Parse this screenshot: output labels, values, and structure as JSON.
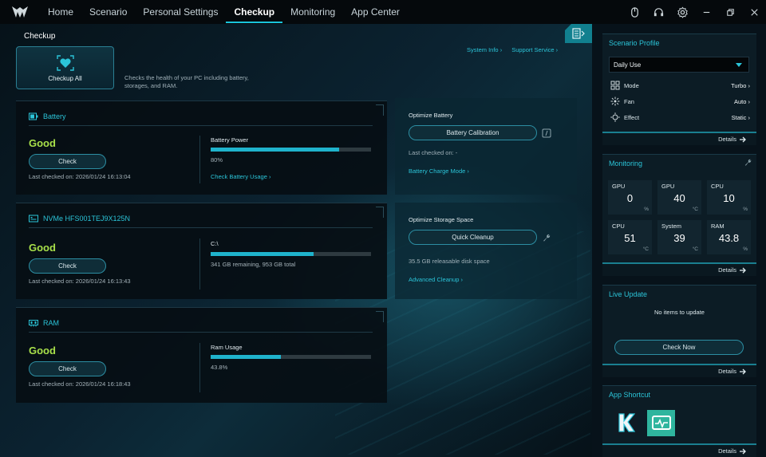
{
  "nav": {
    "tabs": [
      "Home",
      "Scenario",
      "Personal Settings",
      "Checkup",
      "Monitoring",
      "App Center"
    ],
    "active_index": 3
  },
  "page": {
    "title": "Checkup",
    "checkup_all_label": "Checkup All",
    "description": "Checks the health of your PC including battery, storages, and RAM.",
    "system_info_link": "System Info",
    "support_service_link": "Support Service"
  },
  "battery": {
    "title": "Battery",
    "status": "Good",
    "check_label": "Check",
    "last_checked": "Last checked on: 2026/01/24 16:13:04",
    "meter_label": "Battery Power",
    "meter_percent": 80,
    "meter_value": "80%",
    "link": "Check Battery Usage"
  },
  "storage": {
    "title": "NVMe HFS001TEJ9X125N",
    "status": "Good",
    "check_label": "Check",
    "last_checked": "Last checked on: 2026/01/24 16:13:43",
    "meter_label": "C:\\",
    "meter_percent": 64.2,
    "meter_value": "341 GB remaining, 953 GB total"
  },
  "ram": {
    "title": "RAM",
    "status": "Good",
    "check_label": "Check",
    "last_checked": "Last checked on: 2026/01/24 16:18:43",
    "meter_label": "Ram Usage",
    "meter_percent": 43.8,
    "meter_value": "43.8%"
  },
  "optimize_battery": {
    "title": "Optimize Battery",
    "button": "Battery Calibration",
    "last_checked": "Last checked on: -",
    "link": "Battery Charge Mode"
  },
  "optimize_storage": {
    "title": "Optimize Storage Space",
    "button": "Quick Cleanup",
    "info": "35.5 GB releasable disk space",
    "link": "Advanced Cleanup"
  },
  "scenario_profile": {
    "title": "Scenario Profile",
    "selected": "Daily Use",
    "rows": [
      {
        "label": "Mode",
        "value": "Turbo"
      },
      {
        "label": "Fan",
        "value": "Auto"
      },
      {
        "label": "Effect",
        "value": "Static"
      }
    ],
    "details": "Details"
  },
  "monitoring": {
    "title": "Monitoring",
    "tiles": [
      {
        "label": "GPU",
        "value": "0",
        "unit": "%"
      },
      {
        "label": "GPU",
        "value": "40",
        "unit": "°C"
      },
      {
        "label": "CPU",
        "value": "10",
        "unit": "%"
      },
      {
        "label": "CPU",
        "value": "51",
        "unit": "°C"
      },
      {
        "label": "System",
        "value": "39",
        "unit": "°C"
      },
      {
        "label": "RAM",
        "value": "43.8",
        "unit": "%"
      }
    ],
    "details": "Details"
  },
  "live_update": {
    "title": "Live Update",
    "message": "No items to update",
    "button": "Check Now",
    "details": "Details"
  },
  "app_shortcut": {
    "title": "App Shortcut",
    "details": "Details"
  },
  "colors": {
    "accent": "#19c3da",
    "good": "#a8e04a"
  }
}
